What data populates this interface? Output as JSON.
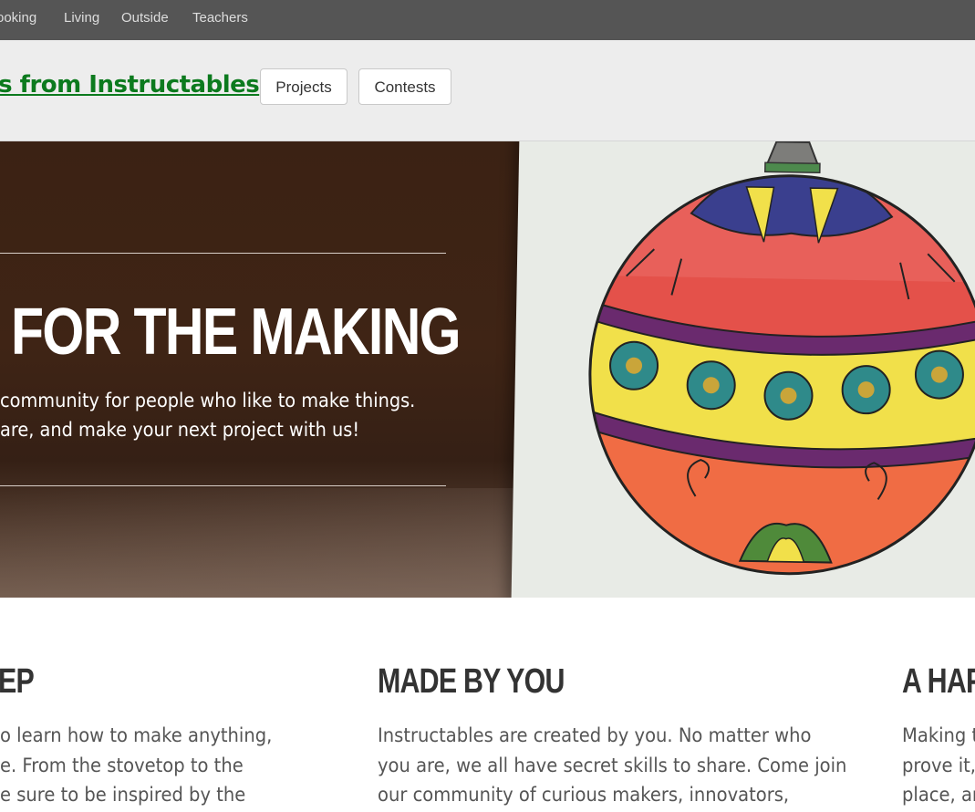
{
  "nav": {
    "categories": [
      "ooking",
      "Living",
      "Outside",
      "Teachers"
    ]
  },
  "header": {
    "brand": "gs from Instructables",
    "projects_label": "Projects",
    "contests_label": "Contests"
  },
  "hero": {
    "title": "FOR THE MAKING",
    "line1": "community for people who like to make things.",
    "line2": "are, and make your next project with us!"
  },
  "columns": [
    {
      "title": "EP",
      "lines": [
        "o learn how to make anything,",
        "e. From the stovetop to the",
        "e sure to be inspired by the"
      ]
    },
    {
      "title": "MADE BY YOU",
      "lines": [
        "Instructables are created by you. No matter who",
        "you are, we all have secret skills to share. Come join",
        "our community of curious makers, innovators,"
      ]
    },
    {
      "title": "A HAP",
      "lines": [
        "Making t",
        "prove it,",
        "place, an"
      ]
    }
  ],
  "colors": {
    "brand_green": "#0c7a1e",
    "topbar": "#555555",
    "header_bg": "#ededed",
    "ornament_red": "#e4514a",
    "ornament_yellow": "#f1e04a"
  }
}
